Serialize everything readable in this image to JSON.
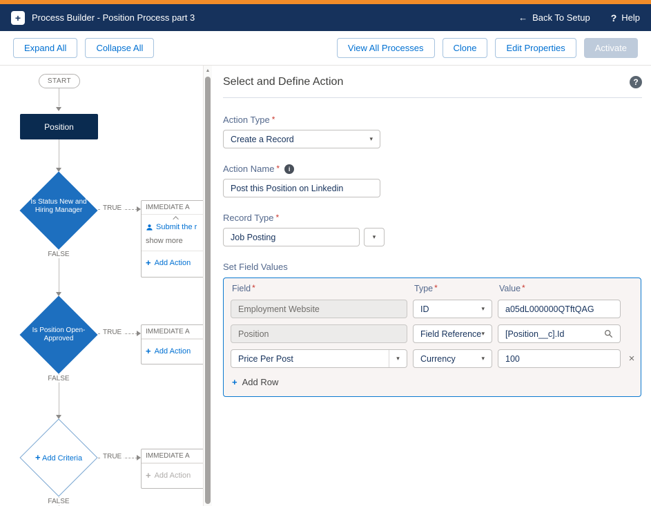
{
  "colors": {
    "accent_orange": "#f28c28",
    "header_navy": "#16325c",
    "brand_blue": "#0070d2",
    "diamond_blue": "#1d6fbf",
    "node_navy": "#0a2b50",
    "required_red": "#c9382f",
    "table_border_blue": "#0b79d0"
  },
  "glyphs": {
    "required": "*",
    "back_arrow": "←",
    "help_q": "?",
    "info_i": "i",
    "caret": "▾",
    "plus": "+",
    "remove": "×",
    "scroll_up": "▲",
    "app_plus": "+"
  },
  "header": {
    "title": "Process Builder - Position Process part 3",
    "back": "Back To Setup",
    "help": "Help"
  },
  "toolbar": {
    "expand_all": "Expand All",
    "collapse_all": "Collapse All",
    "view_all_processes": "View All Processes",
    "clone": "Clone",
    "edit_properties": "Edit Properties",
    "activate": "Activate"
  },
  "canvas": {
    "start_label": "START",
    "position_label": "Position",
    "true_label": "TRUE",
    "false_label": "FALSE",
    "diamond1_label": "Is Status New and Hiring Manager",
    "diamond2_label": "Is Position Open-Approved",
    "diamond3_label": "Add Criteria",
    "immediate_header": "IMMEDIATE A",
    "action_item": "Submit the r",
    "show_more": "show more",
    "add_action": "Add Action"
  },
  "panel": {
    "title": "Select and Define Action",
    "action_type_label": "Action Type",
    "action_type_value": "Create a Record",
    "action_name_label": "Action Name",
    "action_name_value": "Post this Position on Linkedin",
    "record_type_label": "Record Type",
    "record_type_value": "Job Posting",
    "set_field_values_label": "Set Field Values",
    "columns": {
      "field": "Field",
      "type": "Type",
      "value": "Value"
    },
    "rows": [
      {
        "field": "Employment Website",
        "type": "ID",
        "value": "a05dL000000QTftQAG"
      },
      {
        "field": "Position",
        "type": "Field Reference",
        "value": "[Position__c].Id"
      },
      {
        "field": "Price Per Post",
        "type": "Currency",
        "value": "100"
      }
    ],
    "add_row": "Add Row"
  }
}
